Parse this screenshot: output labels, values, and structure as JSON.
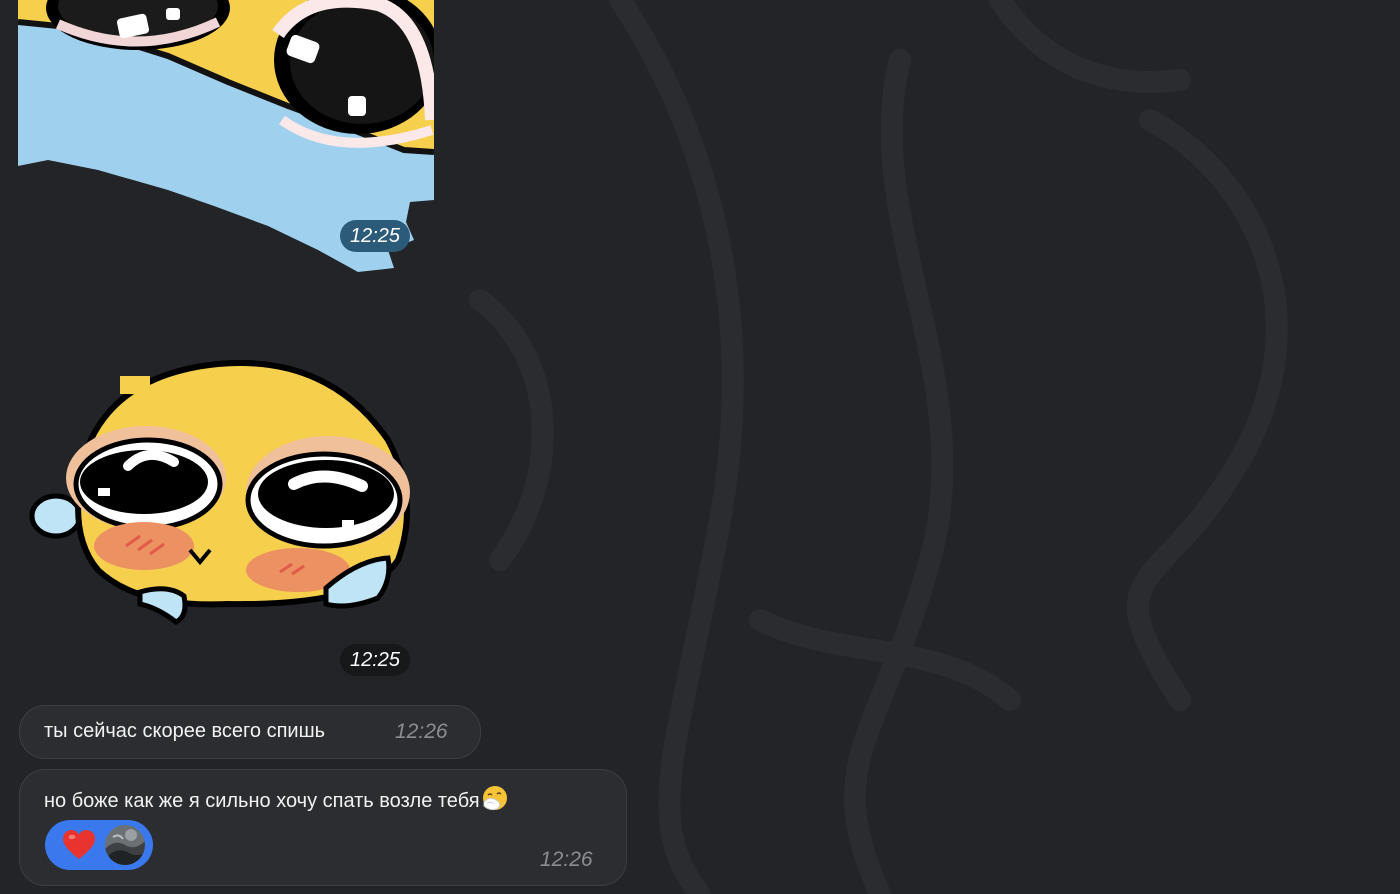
{
  "messages": [
    {
      "type": "sticker",
      "sticker": "crying-cat-face-closeup-sticker",
      "time": "12:25"
    },
    {
      "type": "sticker",
      "sticker": "blushing-smiley-sticker",
      "time": "12:25"
    },
    {
      "type": "text",
      "text": "ты сейчас скорее всего спишь",
      "time": "12:26"
    },
    {
      "type": "text",
      "text": "но боже как же я сильно хочу спать возле тебя",
      "emoji": "sneezing-face-icon",
      "time": "12:26",
      "reaction": {
        "emoji": "red-heart-icon",
        "reactor": "avatar"
      }
    }
  ],
  "colors": {
    "background": "#222427",
    "bubble": "#2c2d30",
    "reaction": "#3a78ee",
    "time_pill_dark": "#16181a",
    "time_pill_blue": "#2c5b7a"
  }
}
